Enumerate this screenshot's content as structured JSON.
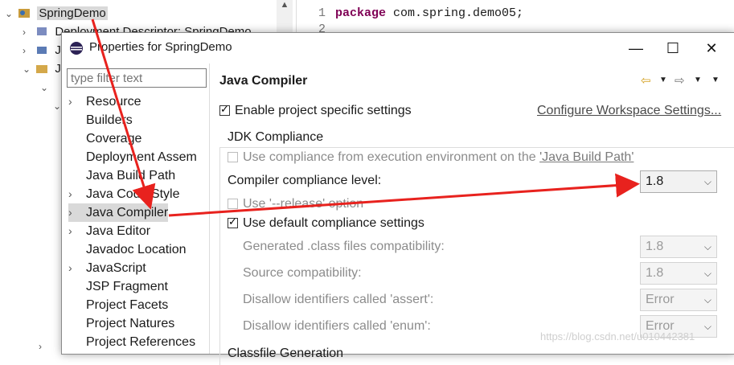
{
  "tree": {
    "project": "SpringDemo",
    "items": [
      {
        "label": "Deployment Descriptor: SpringDemo"
      },
      {
        "label": "JA"
      },
      {
        "label": "Ja"
      }
    ]
  },
  "editor": {
    "lines": [
      {
        "num": "1",
        "keyword": "package",
        "text": "com.spring.demo05;"
      },
      {
        "num": "2",
        "keyword": "",
        "text": ""
      }
    ]
  },
  "dialog": {
    "title": "Properties for SpringDemo",
    "minimize": "—",
    "maximize": "☐",
    "close": "✕",
    "filter_placeholder": "type filter text",
    "nav": [
      {
        "label": "Resource",
        "expandable": true
      },
      {
        "label": "Builders",
        "expandable": false
      },
      {
        "label": "Coverage",
        "expandable": false
      },
      {
        "label": "Deployment Assem",
        "expandable": false
      },
      {
        "label": "Java Build Path",
        "expandable": false
      },
      {
        "label": "Java Code Style",
        "expandable": true
      },
      {
        "label": "Java Compiler",
        "expandable": true,
        "selected": true
      },
      {
        "label": "Java Editor",
        "expandable": true
      },
      {
        "label": "Javadoc Location",
        "expandable": false
      },
      {
        "label": "JavaScript",
        "expandable": true
      },
      {
        "label": "JSP Fragment",
        "expandable": false
      },
      {
        "label": "Project Facets",
        "expandable": false
      },
      {
        "label": "Project Natures",
        "expandable": false
      },
      {
        "label": "Project References",
        "expandable": false
      }
    ],
    "page": {
      "title": "Java Compiler",
      "enable_specific": "Enable project specific settings",
      "configure_link": "Configure Workspace Settings...",
      "group_title": "JDK Compliance",
      "use_env": "Use compliance from execution environment on the ",
      "use_env_link": "'Java Build Path'",
      "compliance_label": "Compiler compliance level:",
      "compliance_value": "1.8",
      "use_release": "Use '--release' option",
      "use_default": "Use default compliance settings",
      "generated_label": "Generated .class files compatibility:",
      "generated_value": "1.8",
      "source_label": "Source compatibility:",
      "source_value": "1.8",
      "assert_label": "Disallow identifiers called 'assert':",
      "assert_value": "Error",
      "enum_label": "Disallow identifiers called 'enum':",
      "enum_value": "Error",
      "next_group": "Classfile Generation"
    }
  },
  "watermark": "https://blog.csdn.net/u010442381",
  "colors": {
    "annotation_arrow": "#e8221e",
    "keyword": "#7f0055"
  }
}
